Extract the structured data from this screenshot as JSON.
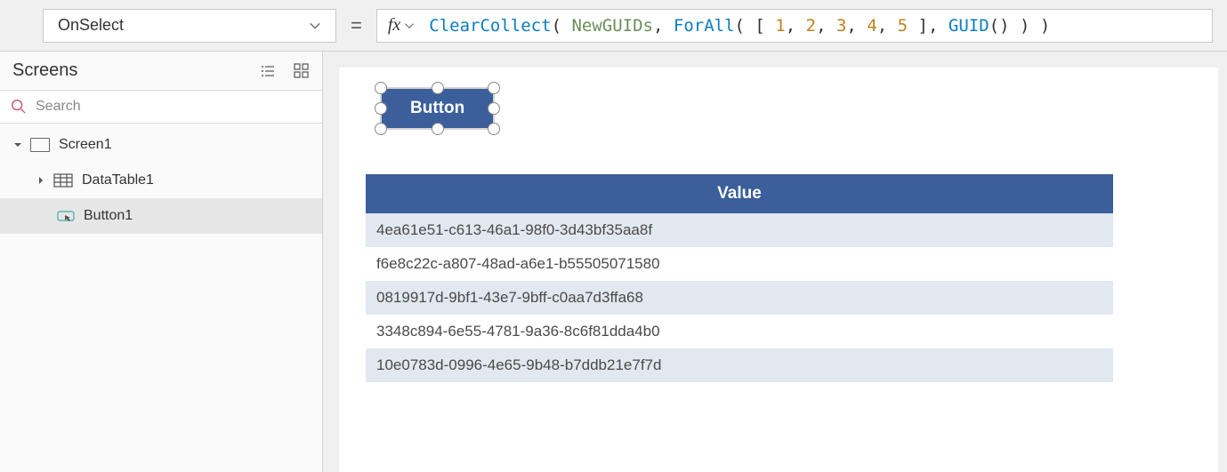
{
  "topbar": {
    "property": "OnSelect",
    "fx_label": "fx",
    "equals": "=",
    "formula": {
      "tokens": [
        {
          "t": "ClearCollect",
          "c": "fn"
        },
        {
          "t": "( ",
          "c": "pn"
        },
        {
          "t": "NewGUIDs",
          "c": "id"
        },
        {
          "t": ", ",
          "c": "pn"
        },
        {
          "t": "ForAll",
          "c": "fn"
        },
        {
          "t": "( [ ",
          "c": "pn"
        },
        {
          "t": "1",
          "c": "num"
        },
        {
          "t": ", ",
          "c": "pn"
        },
        {
          "t": "2",
          "c": "num"
        },
        {
          "t": ", ",
          "c": "pn"
        },
        {
          "t": "3",
          "c": "num"
        },
        {
          "t": ", ",
          "c": "pn"
        },
        {
          "t": "4",
          "c": "num"
        },
        {
          "t": ", ",
          "c": "pn"
        },
        {
          "t": "5",
          "c": "num"
        },
        {
          "t": " ], ",
          "c": "pn"
        },
        {
          "t": "GUID",
          "c": "fn"
        },
        {
          "t": "() ) )",
          "c": "pn"
        }
      ]
    }
  },
  "leftpanel": {
    "title": "Screens",
    "search_placeholder": "Search",
    "tree": {
      "screen": "Screen1",
      "datatable": "DataTable1",
      "button": "Button1"
    }
  },
  "canvas": {
    "button_label": "Button",
    "table": {
      "header": "Value",
      "rows": [
        "4ea61e51-c613-46a1-98f0-3d43bf35aa8f",
        "f6e8c22c-a807-48ad-a6e1-b55505071580",
        "0819917d-9bf1-43e7-9bff-c0aa7d3ffa68",
        "3348c894-6e55-4781-9a36-8c6f81dda4b0",
        "10e0783d-0996-4e65-9b48-b7ddb21e7f7d"
      ]
    }
  }
}
